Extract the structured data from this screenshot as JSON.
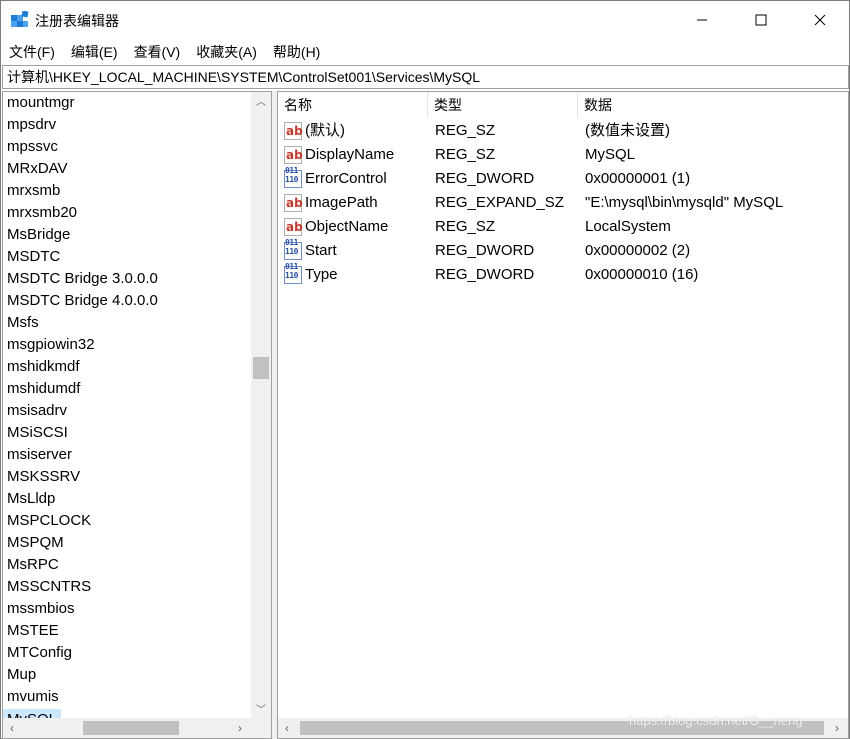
{
  "window": {
    "title": "注册表编辑器",
    "icon": "regedit-icon",
    "controls": {
      "minimize": "minimize-icon",
      "maximize": "maximize-icon",
      "close": "close-icon"
    }
  },
  "menu": [
    {
      "label": "文件(F)"
    },
    {
      "label": "编辑(E)"
    },
    {
      "label": "查看(V)"
    },
    {
      "label": "收藏夹(A)"
    },
    {
      "label": "帮助(H)"
    }
  ],
  "address": {
    "path": "计算机\\HKEY_LOCAL_MACHINE\\SYSTEM\\ControlSet001\\Services\\MySQL"
  },
  "tree": {
    "items": [
      "mountmgr",
      "mpsdrv",
      "mpssvc",
      "MRxDAV",
      "mrxsmb",
      "mrxsmb20",
      "MsBridge",
      "MSDTC",
      "MSDTC Bridge 3.0.0.0",
      "MSDTC Bridge 4.0.0.0",
      "Msfs",
      "msgpiowin32",
      "mshidkmdf",
      "mshidumdf",
      "msisadrv",
      "MSiSCSI",
      "msiserver",
      "MSKSSRV",
      "MsLldp",
      "MSPCLOCK",
      "MSPQM",
      "MsRPC",
      "MSSCNTRS",
      "mssmbios",
      "MSTEE",
      "MTConfig",
      "Mup",
      "mvumis"
    ],
    "selected": "MySQL"
  },
  "values": {
    "headers": {
      "name": "名称",
      "type": "类型",
      "data": "数据"
    },
    "rows": [
      {
        "icon": "string-value-icon",
        "name": "(默认)",
        "type": "REG_SZ",
        "data": "(数值未设置)"
      },
      {
        "icon": "string-value-icon",
        "name": "DisplayName",
        "type": "REG_SZ",
        "data": "MySQL"
      },
      {
        "icon": "binary-value-icon",
        "name": "ErrorControl",
        "type": "REG_DWORD",
        "data": "0x00000001 (1)"
      },
      {
        "icon": "string-value-icon",
        "name": "ImagePath",
        "type": "REG_EXPAND_SZ",
        "data": "\"E:\\mysql\\bin\\mysqld\" MySQL"
      },
      {
        "icon": "string-value-icon",
        "name": "ObjectName",
        "type": "REG_SZ",
        "data": "LocalSystem"
      },
      {
        "icon": "binary-value-icon",
        "name": "Start",
        "type": "REG_DWORD",
        "data": "0x00000002 (2)"
      },
      {
        "icon": "binary-value-icon",
        "name": "Type",
        "type": "REG_DWORD",
        "data": "0x00000010 (16)"
      }
    ]
  },
  "icons": {
    "string": "ab",
    "binary": "011\n110"
  },
  "watermark": "https://blog.csdn.net/G__neng"
}
